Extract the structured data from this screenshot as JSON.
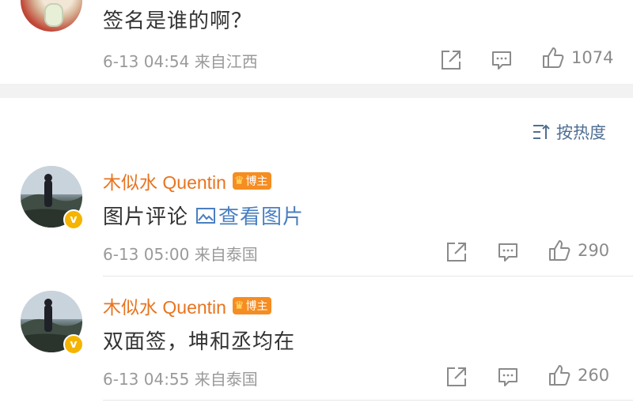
{
  "comments": [
    {
      "text": "签名是谁的啊？",
      "time": "6-13 04:54",
      "source": "来自江西",
      "likes": "1074"
    },
    {
      "user": "木似水 Quentin",
      "badge": "博主",
      "text": "图片评论",
      "link": "查看图片",
      "time": "6-13 05:00",
      "source": "来自泰国",
      "likes": "290"
    },
    {
      "user": "木似水 Quentin",
      "badge": "博主",
      "text": "双面签，坤和丞均在",
      "time": "6-13 04:55",
      "source": "来自泰国",
      "likes": "260"
    }
  ],
  "sort": {
    "label": "按热度"
  },
  "verified_mark": "v",
  "colors": {
    "username": "#e8741f",
    "link": "#4a7fc1",
    "verified": "#f5b400",
    "badge": "#f58d22"
  }
}
